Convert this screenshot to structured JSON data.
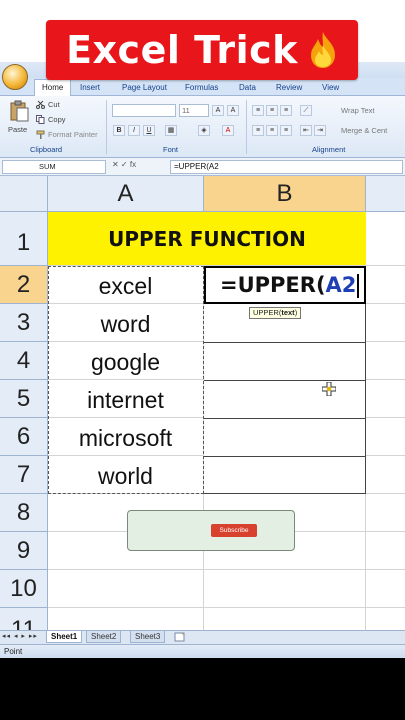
{
  "banner": {
    "title": "Excel Trick"
  },
  "ribbon": {
    "tabs": [
      "Home",
      "Insert",
      "Page Layout",
      "Formulas",
      "Data",
      "Review",
      "View"
    ],
    "active_tab": "Home",
    "clipboard": {
      "paste": "Paste",
      "cut": "Cut",
      "copy": "Copy",
      "format_painter": "Format Painter",
      "group": "Clipboard"
    },
    "font": {
      "size": "11",
      "bold": "B",
      "italic": "I",
      "underline": "U",
      "group": "Font"
    },
    "alignment": {
      "wrap_text": "Wrap Text",
      "merge": "Merge & Cent",
      "group": "Alignment"
    }
  },
  "formula_bar": {
    "name_box": "SUM",
    "icons": "✕ ✓ fx",
    "formula": "=UPPER(A2"
  },
  "grid": {
    "columns": [
      "A",
      "B"
    ],
    "rows": [
      "1",
      "2",
      "3",
      "4",
      "5",
      "6",
      "7",
      "8",
      "9",
      "10",
      "11"
    ],
    "title": "UPPER FUNCTION",
    "col_a": [
      "excel",
      "word",
      "google",
      "internet",
      "microsoft",
      "world"
    ],
    "edit": {
      "prefix": "=UPPER(",
      "ref": "A2"
    },
    "tooltip": {
      "func": "UPPER(",
      "arg": "text",
      "close": ")"
    }
  },
  "overlay": {
    "subscribe": "Subscribe"
  },
  "sheets": {
    "tabs": [
      "Sheet1",
      "Sheet2",
      "Sheet3"
    ],
    "active": "Sheet1",
    "nav": "◂◂ ◂ ▸ ▸▸"
  },
  "status": {
    "mode": "Point"
  },
  "colors": {
    "banner": "#e8161b",
    "title_fill": "#fff200",
    "ref_blue": "#1f3fb4",
    "header_selected": "#f8d48e"
  }
}
